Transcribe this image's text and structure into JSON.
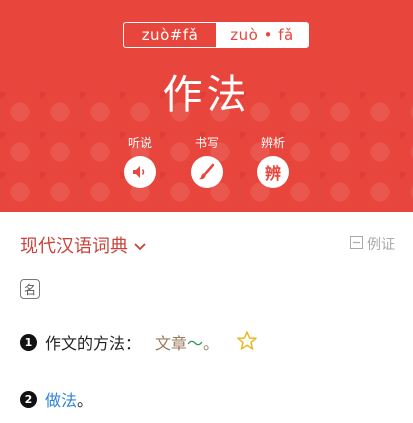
{
  "header": {
    "pinyin_toggle": {
      "option1": "zuò#fǎ",
      "option2": "zuò • fǎ"
    },
    "word": "作法",
    "actions": [
      {
        "label": "听说"
      },
      {
        "label": "书写"
      },
      {
        "label": "辨析",
        "icon_text": "辨"
      }
    ],
    "colors": {
      "brand": "#e8463c"
    }
  },
  "dictionary": {
    "title": "现代汉语词典",
    "example_toggle": "例证",
    "pos": "名",
    "definitions": [
      {
        "num": "1",
        "text": "作文的方法：",
        "example_word": "文章",
        "example_tilde": "～",
        "example_end": "。"
      },
      {
        "num": "2",
        "link": "做法",
        "end": "。"
      }
    ]
  }
}
